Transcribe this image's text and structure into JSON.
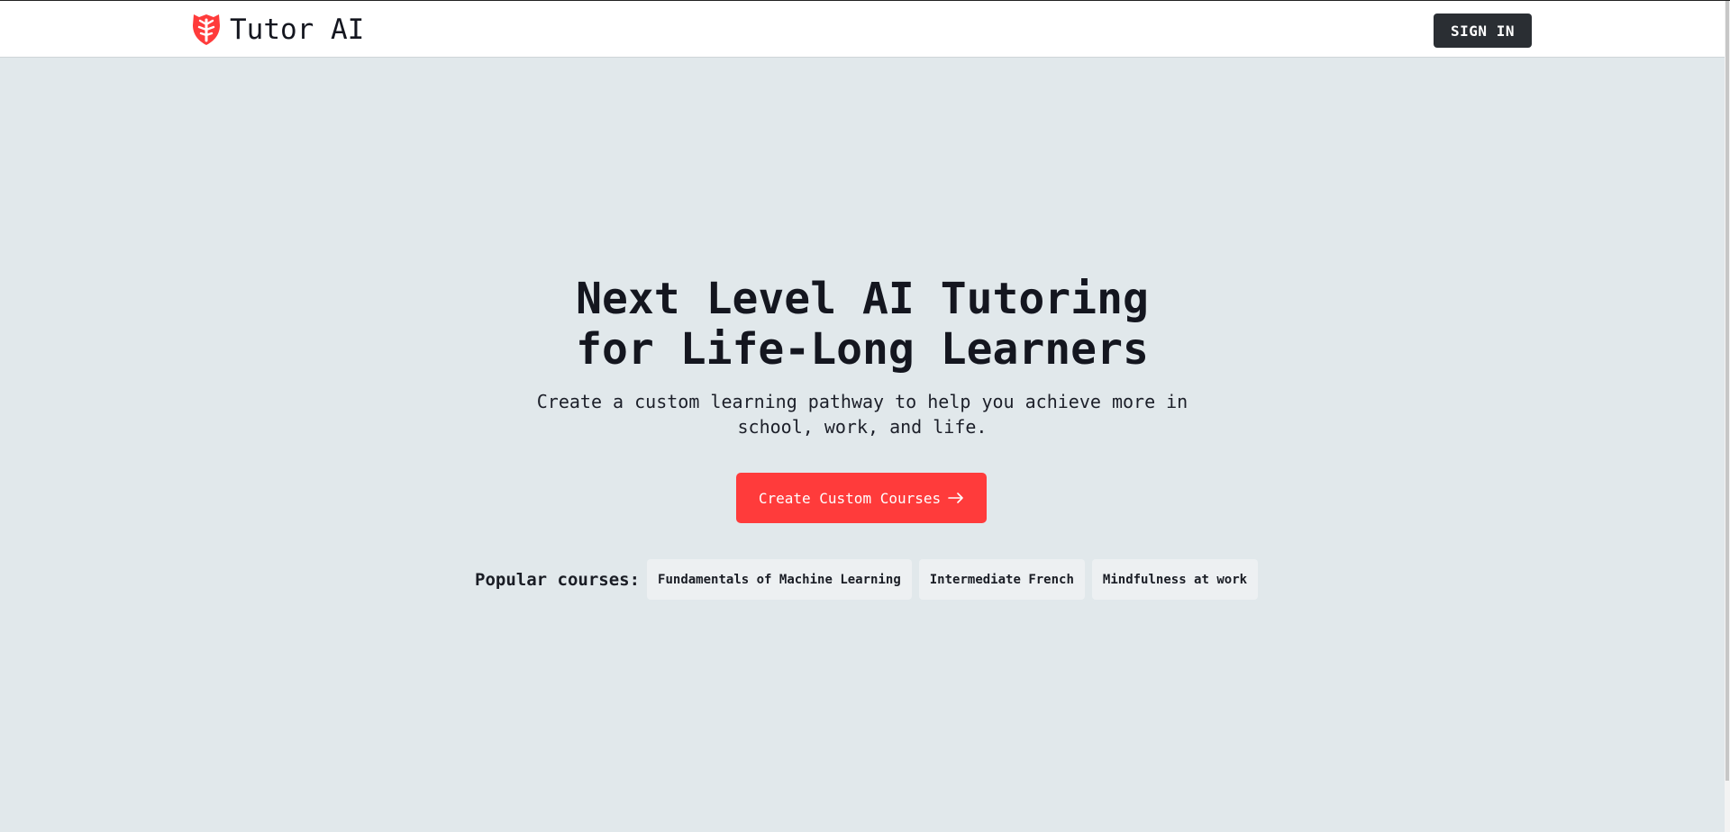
{
  "header": {
    "brand_name": "Tutor AI",
    "brand_icon": "shield-logo-icon",
    "sign_in_label": "SIGN IN"
  },
  "hero": {
    "title_line1": "Next Level AI Tutoring",
    "title_line2": "for Life-Long Learners",
    "subtitle_line1": "Create a custom learning pathway to help you achieve more in",
    "subtitle_line2": "school, work, and life.",
    "cta_label": "Create Custom Courses",
    "cta_icon": "arrow-right-icon"
  },
  "popular": {
    "label": "Popular courses:",
    "courses": [
      "Fundamentals of Machine Learning",
      "Intermediate French",
      "Mindfulness at work"
    ]
  },
  "colors": {
    "accent": "#ff3b3b",
    "background": "#e1e8eb",
    "header_bg": "#ffffff",
    "dark_button": "#2a2e33",
    "chip_bg": "#edf0f2"
  }
}
